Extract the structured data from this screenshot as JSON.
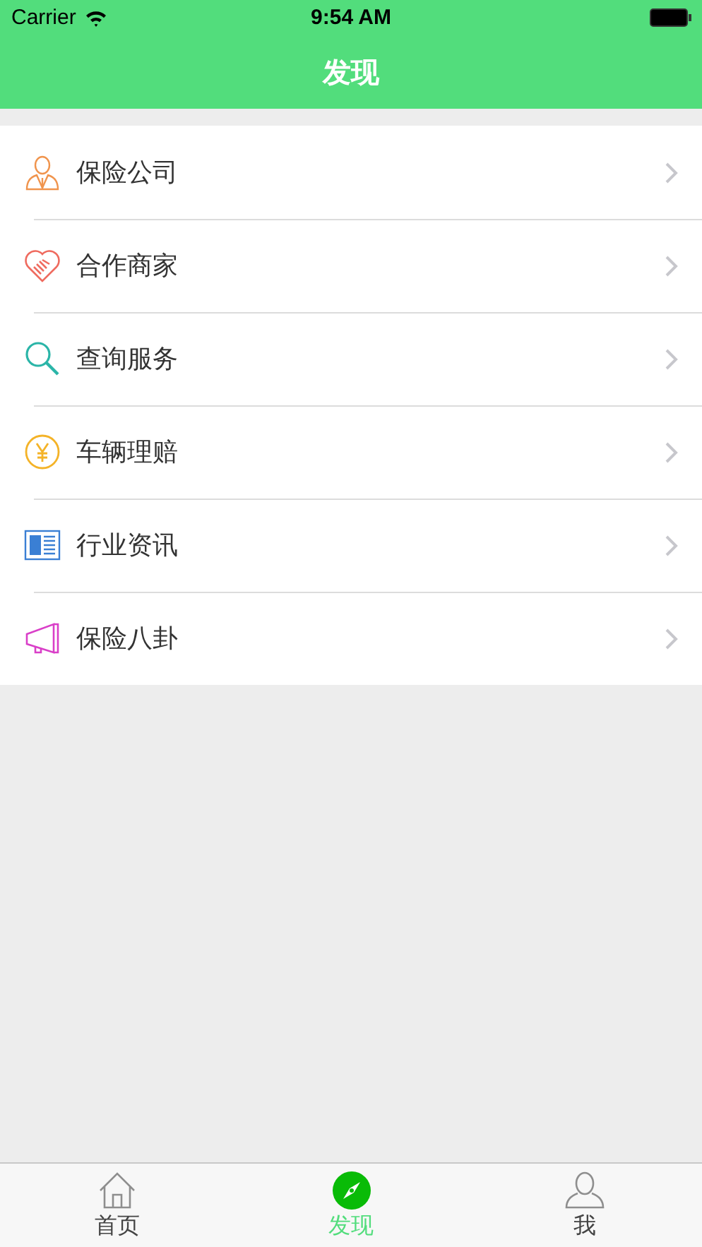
{
  "status_bar": {
    "carrier": "Carrier",
    "time": "9:54 AM"
  },
  "nav": {
    "title": "发现"
  },
  "items": [
    {
      "kind": "person",
      "label": "保险公司"
    },
    {
      "kind": "handshake",
      "label": "合作商家"
    },
    {
      "kind": "search",
      "label": "查询服务"
    },
    {
      "kind": "yen",
      "label": "车辆理赔"
    },
    {
      "kind": "news",
      "label": "行业资讯"
    },
    {
      "kind": "megaphone",
      "label": "保险八卦"
    }
  ],
  "tabs": [
    {
      "kind": "home",
      "label": "首页",
      "selected": false
    },
    {
      "kind": "compass",
      "label": "发现",
      "selected": true
    },
    {
      "kind": "user",
      "label": "我",
      "selected": false
    }
  ]
}
